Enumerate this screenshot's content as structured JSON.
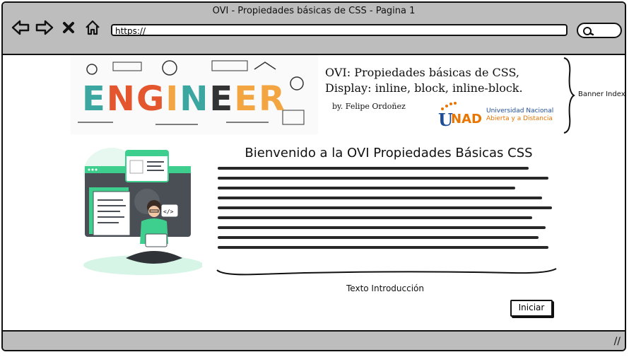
{
  "window": {
    "title": "OVI - Propiedades básicas de CSS - Pagina 1",
    "url": "https://"
  },
  "banner": {
    "image_text": "ENGINEER",
    "title": "OVI: Propiedades básicas de CSS, Display: inline, block, inline-block.",
    "byline": "by. Felipe Ordoñez",
    "logo_text": "UNAD",
    "institution_line1": "Universidad Nacional",
    "institution_line2": "Abierta y a Distancia",
    "label": "Banner Index"
  },
  "main": {
    "heading": "Bienvenido a la OVI Propiedades Básicas CSS",
    "intro_label": "Texto Introducción",
    "start_button": "Iniciar"
  },
  "colors": {
    "chrome": "#bdbdbd",
    "accent_green": "#3ecf8e",
    "unad_blue": "#1f4e99",
    "unad_orange": "#e87500"
  }
}
